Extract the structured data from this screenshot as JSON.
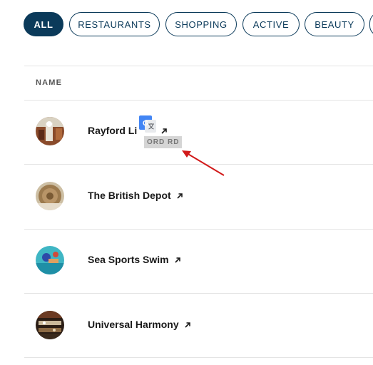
{
  "filters": {
    "all": "ALL",
    "restaurants": "RESTAURANTS",
    "shopping": "SHOPPING",
    "active": "ACTIVE",
    "beauty": "BEAUTY",
    "selected": "ALL"
  },
  "table": {
    "header_name": "NAME",
    "rows": [
      {
        "name": "Rayford Li",
        "avatar": "photo"
      },
      {
        "name": "The British Depot",
        "avatar": "photo"
      },
      {
        "name": "Sea Sports Swim",
        "avatar": "photo"
      },
      {
        "name": "Universal Harmony",
        "avatar": "photo"
      }
    ]
  },
  "overlay": {
    "translate_icon": "google-translate-icon",
    "tooltip_text": "ORD RD",
    "annotation_arrow_color": "#d11a1a"
  },
  "colors": {
    "accent": "#0b3a5a",
    "divider": "#e4e4e4"
  }
}
